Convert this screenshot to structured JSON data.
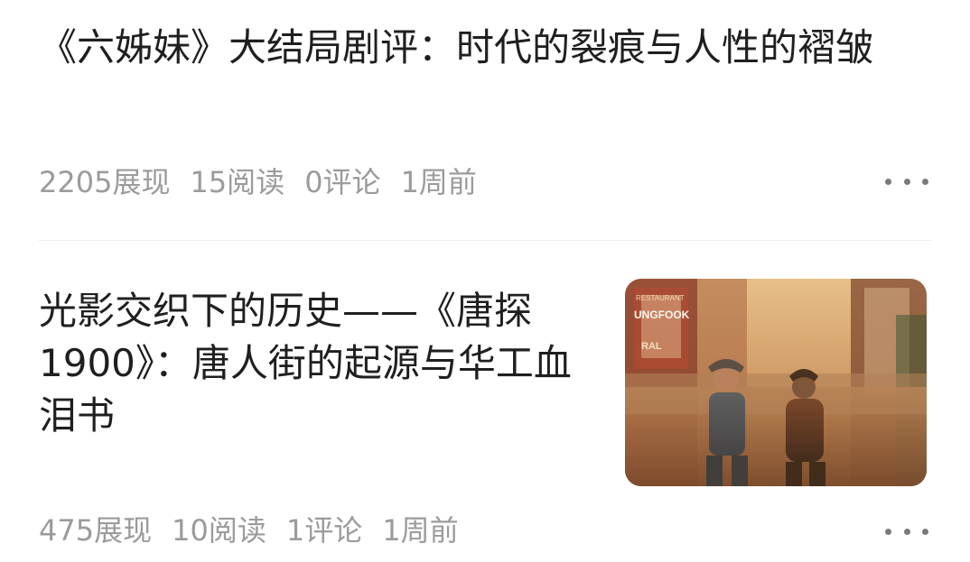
{
  "articles": [
    {
      "title": "《六姊妹》大结局剧评：时代的裂痕与人性的褶皱",
      "views": "2205展现",
      "reads": "15阅读",
      "comments": "0评论",
      "time": "1周前",
      "more_icon": "more-horizontal-icon"
    },
    {
      "title": "光影交织下的历史——《唐探1900》：唐人街的起源与华工血泪书",
      "views": "475展现",
      "reads": "10阅读",
      "comments": "1评论",
      "time": "1周前",
      "more_icon": "more-horizontal-icon",
      "thumbnail": {
        "icon": "movie-poster-thumbnail",
        "sign_text": "UNGFOOK",
        "sign_sub": "RESTAURANT",
        "sign_bottom": "RAL"
      }
    }
  ]
}
